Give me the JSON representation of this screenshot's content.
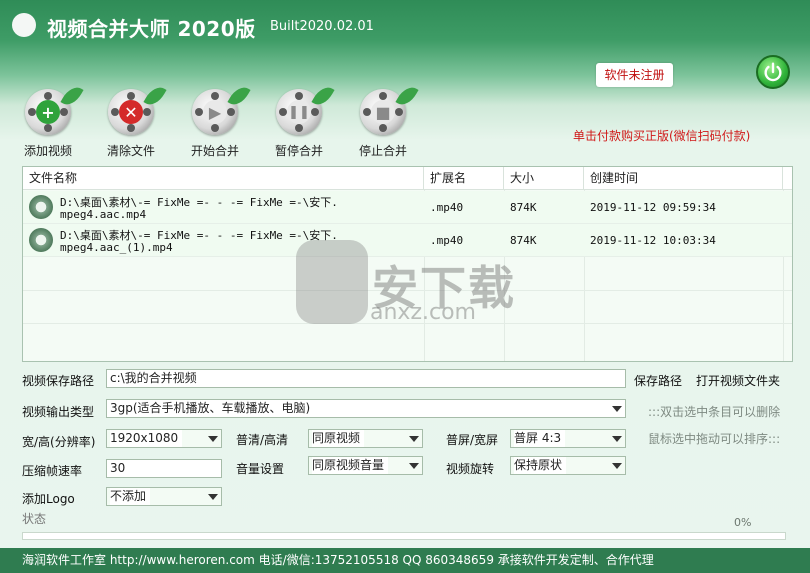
{
  "window": {
    "title": "视频合并大师 2020版",
    "build": "Built2020.02.01"
  },
  "register_badge": "软件未注册",
  "buy_link": "单击付款购买正版(微信扫码付款)",
  "toolbar": [
    {
      "label": "添加视频",
      "icon": "plus-icon",
      "color": "#2fa33b"
    },
    {
      "label": "清除文件",
      "icon": "x-icon",
      "color": "#d42a2a"
    },
    {
      "label": "开始合并",
      "icon": "play-icon",
      "color": "#9a9a9a"
    },
    {
      "label": "暂停合并",
      "icon": "pause-icon",
      "color": "#9a9a9a"
    },
    {
      "label": "停止合并",
      "icon": "stop-icon",
      "color": "#9a9a9a"
    }
  ],
  "table": {
    "columns": [
      "文件名称",
      "扩展名",
      "大小",
      "创建时间"
    ],
    "rows": [
      {
        "name_line1": "D:\\桌面\\素材\\-= FixMe =- - -= FixMe =-\\安下.",
        "name_line2": "mpeg4.aac.mp4",
        "ext": ".mp40",
        "size": "874K",
        "created": "2019-11-12 09:59:34"
      },
      {
        "name_line1": "D:\\桌面\\素材\\-= FixMe =- - -= FixMe =-\\安下.",
        "name_line2": "mpeg4.aac_(1).mp4",
        "ext": ".mp40",
        "size": "874K",
        "created": "2019-11-12 10:03:34"
      }
    ]
  },
  "watermark": {
    "text": "安下载",
    "url": "anxz.com"
  },
  "form": {
    "save_path_label": "视频保存路径",
    "save_path_value": "c:\\我的合并视频",
    "save_path_button": "保存路径",
    "open_folder_button": "打开视频文件夹",
    "output_type_label": "视频输出类型",
    "output_type_value": "3gp(适合手机播放、车载播放、电脑)",
    "hint_double_click": ":::双击选中条目可以删除",
    "hint_drag": "鼠标选中拖动可以排序:::",
    "resolution_label": "宽/高(分辨率)",
    "resolution_value": "1920x1080",
    "quality_label": "普清/高清",
    "quality_value": "同原视频",
    "aspect_label": "普屏/宽屏",
    "aspect_value": "普屏 4:3",
    "framerate_label": "压缩帧速率",
    "framerate_value": "30",
    "volume_label": "音量设置",
    "volume_value": "同原视频音量",
    "rotate_label": "视频旋转",
    "rotate_value": "保持原状",
    "logo_label": "添加Logo",
    "logo_value": "不添加"
  },
  "status": {
    "label": "状态",
    "progress": 0,
    "progress_text": "0%"
  },
  "footer": "海润软件工作室 http://www.heroren.com  电话/微信:13752105518  QQ 860348659 承接软件开发定制、合作代理"
}
